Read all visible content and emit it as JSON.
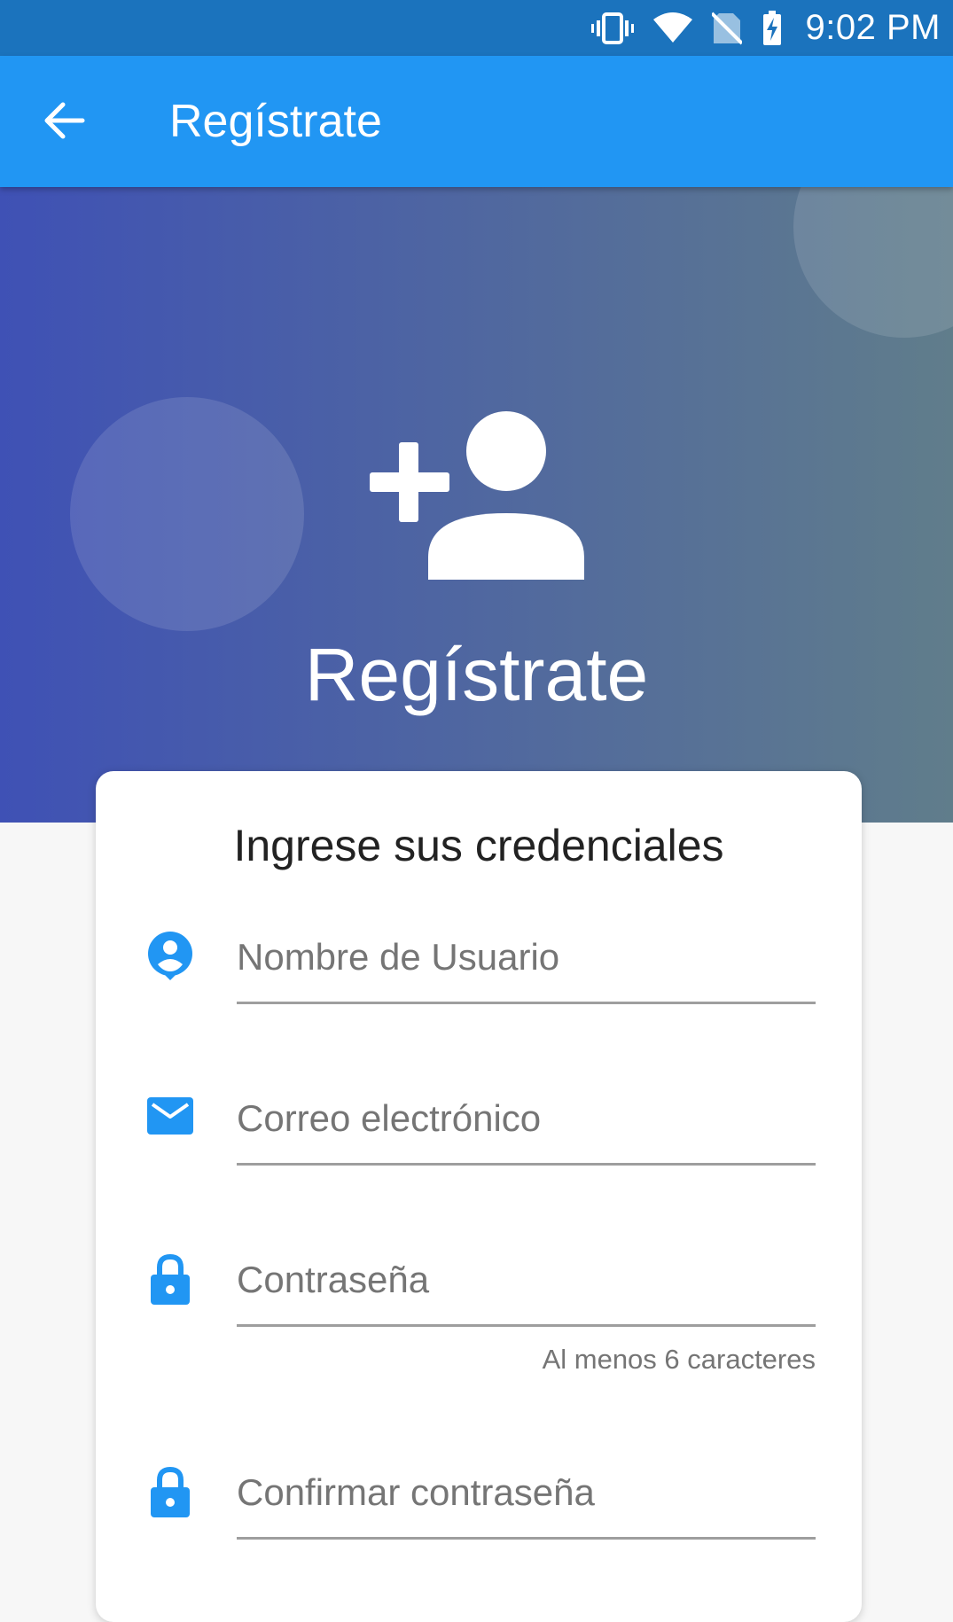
{
  "status_bar": {
    "time": "9:02 PM",
    "icons": [
      "vibrate-icon",
      "wifi-icon",
      "no-sim-icon",
      "battery-charging-icon"
    ]
  },
  "app_bar": {
    "title": "Regístrate",
    "back_icon": "arrow-back-icon",
    "color": "#2196f3"
  },
  "hero": {
    "title": "Regístrate",
    "icon": "person-add-icon",
    "gradient": [
      "#3f51b5",
      "#607d8b"
    ]
  },
  "form": {
    "title": "Ingrese sus credenciales",
    "accent": "#2196f3",
    "fields": [
      {
        "icon": "account-circle-icon",
        "placeholder": "Nombre de Usuario",
        "value": ""
      },
      {
        "icon": "email-icon",
        "placeholder": "Correo electrónico",
        "value": ""
      },
      {
        "icon": "lock-icon",
        "placeholder": "Contraseña",
        "value": "",
        "helper": "Al menos 6 caracteres"
      },
      {
        "icon": "lock-icon",
        "placeholder": "Confirmar contraseña",
        "value": ""
      }
    ]
  }
}
